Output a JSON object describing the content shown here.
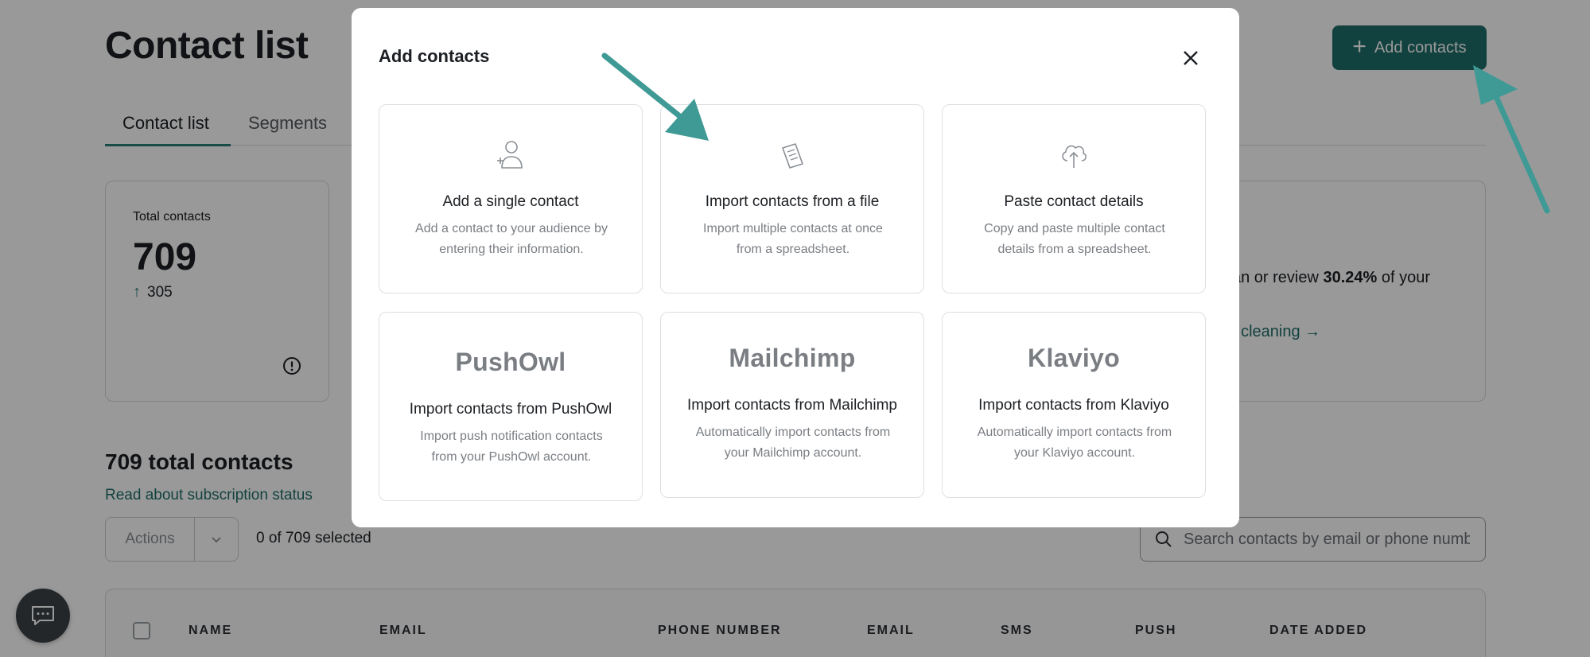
{
  "page": {
    "title": "Contact list",
    "add_contacts_label": "Add contacts",
    "tabs": [
      {
        "label": "Contact list",
        "active": true
      },
      {
        "label": "Segments",
        "active": false
      }
    ],
    "summary": {
      "total_label": "Total contacts",
      "total_value": "709",
      "delta_value": "305"
    },
    "cleaning_card": {
      "text_prefix": "an or review ",
      "percent": "30.24%",
      "text_suffix": " of your",
      "link": "t cleaning →"
    },
    "list_section": {
      "title": "709 total contacts",
      "subscription_link": "Read about subscription status",
      "actions_label": "Actions",
      "selected_prefix": "0 of ",
      "selected_total": "709",
      "selected_suffix": " selected",
      "search_placeholder": "Search contacts by email or phone number"
    },
    "table_columns": [
      "NAME",
      "EMAIL",
      "PHONE NUMBER",
      "EMAIL",
      "SMS",
      "PUSH",
      "DATE ADDED"
    ]
  },
  "modal": {
    "title": "Add contacts",
    "options": [
      {
        "icon": "add-user-icon",
        "title": "Add a single contact",
        "description": "Add a contact to your audience by entering their information."
      },
      {
        "icon": "file-document-icon",
        "title": "Import contacts from a file",
        "description": "Import multiple contacts at once from a spreadsheet."
      },
      {
        "icon": "cloud-upload-icon",
        "title": "Paste contact details",
        "description": "Copy and paste multiple contact details from a spreadsheet."
      },
      {
        "brand": "PushOwl",
        "title": "Import contacts from PushOwl",
        "description": "Import push notification contacts from your PushOwl account."
      },
      {
        "brand": "Mailchimp",
        "title": "Import contacts from Mailchimp",
        "description": "Automatically import contacts from your Mailchimp account."
      },
      {
        "brand": "Klaviyo",
        "title": "Import contacts from Klaviyo",
        "description": "Automatically import contacts from your Klaviyo account."
      }
    ]
  },
  "colors": {
    "accent": "#1f6f6a",
    "annotation_arrow": "#3f9a95",
    "overlay": "rgba(0,0,0,0.40)"
  }
}
